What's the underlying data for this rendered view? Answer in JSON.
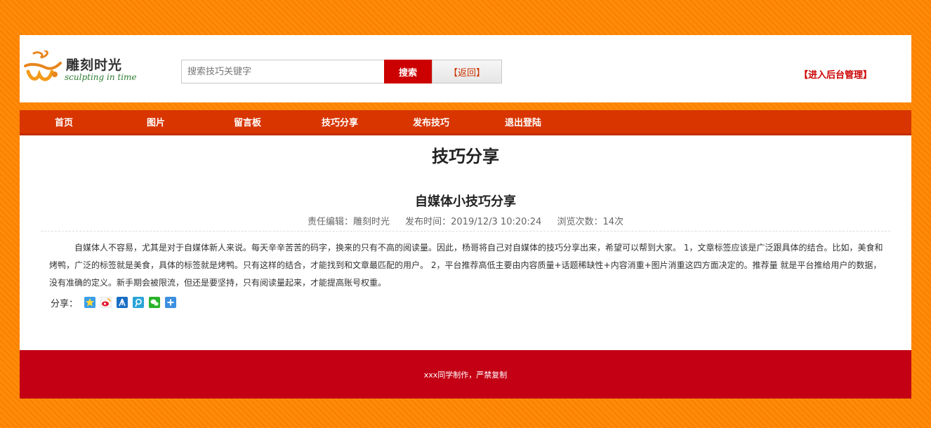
{
  "header": {
    "logo_cn": "雕刻时光",
    "logo_en": "sculpting in time",
    "search_placeholder": "搜索技巧关键字",
    "search_button": "搜索",
    "back_button": "【返回】",
    "admin_link": "【进入后台管理】"
  },
  "nav": {
    "items": [
      {
        "label": "首页"
      },
      {
        "label": "图片"
      },
      {
        "label": "留言板"
      },
      {
        "label": "技巧分享"
      },
      {
        "label": "发布技巧"
      },
      {
        "label": "退出登陆"
      }
    ]
  },
  "content": {
    "section_title": "技巧分享",
    "article_title": "自媒体小技巧分享",
    "meta": {
      "editor": "责任编辑：雕刻时光",
      "publish_time": "发布时间：2019/12/3 10:20:24",
      "views": "浏览次数：14次"
    },
    "body": "自媒体人不容易，尤其是对于自媒体新人来说。每天辛辛苦苦的码字，换来的只有不高的阅读量。因此，杨哥将自己对自媒体的技巧分享出来，希望可以帮到大家。 1，文章标签应该是广泛跟具体的结合。比如，美食和烤鸭，广泛的标签就是美食，具体的标签就是烤鸭。只有这样的结合，才能找到和文章最匹配的用户。 2，平台推荐高低主要由内容质量+话题稀缺性+内容消重+图片消重这四方面决定的。推荐量 就是平台推给用户的数据，没有准确的定义。新手期会被限流，但还是要坚持，只有阅读量起来，才能提高账号权重。",
    "share_label": "分享：",
    "share_icons": [
      "qzone-icon",
      "weibo-icon",
      "renren-icon",
      "tencent-weibo-icon",
      "wechat-icon",
      "more-share-icon"
    ]
  },
  "footer": {
    "text": "xxx同学制作，严禁复制"
  },
  "colors": {
    "background": "#ff8500",
    "nav": "#d83500",
    "footer": "#c40014",
    "accent_red": "#cc0000"
  }
}
